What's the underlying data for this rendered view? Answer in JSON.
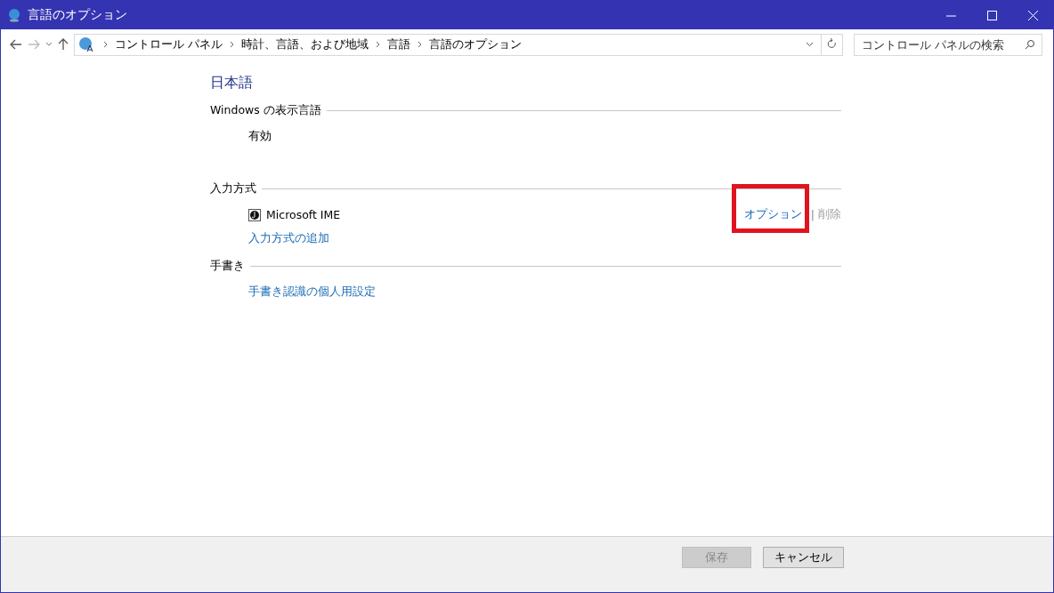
{
  "window": {
    "title": "言語のオプション"
  },
  "breadcrumb": [
    "コントロール パネル",
    "時計、言語、および地域",
    "言語",
    "言語のオプション"
  ],
  "search": {
    "placeholder": "コントロール パネルの検索"
  },
  "language": "日本語",
  "sections": [
    {
      "kind": "display",
      "title": "Windows の表示言語",
      "status": "有効"
    },
    {
      "kind": "input",
      "title": "入力方式",
      "methods": [
        {
          "name": "Microsoft IME",
          "options_link": "オプション",
          "separator": "|",
          "remove_link": "削除",
          "remove_disabled": true,
          "highlighted": true
        }
      ],
      "add_link": "入力方式の追加"
    },
    {
      "kind": "handwriting",
      "title": "手書き",
      "link": "手書き認識の個人用設定"
    }
  ],
  "buttons": [
    {
      "label": "保存",
      "disabled": true
    },
    {
      "label": "キャンセル",
      "disabled": false
    }
  ]
}
